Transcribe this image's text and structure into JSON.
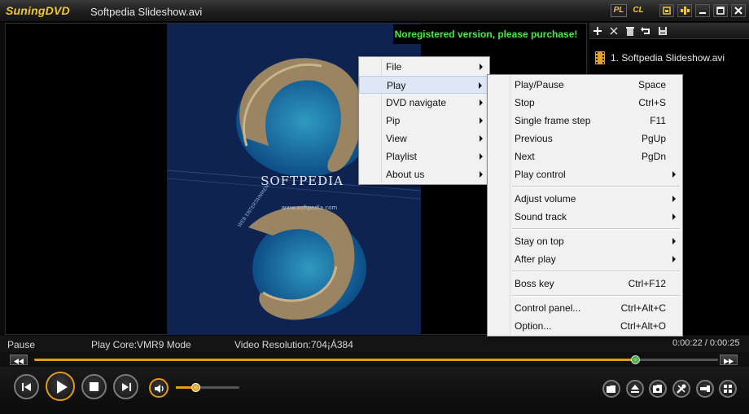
{
  "app": {
    "logo": "SuningDVD",
    "file_title": "Softpedia Slideshow.avi",
    "pl_label": "PL",
    "cl_label": "CL"
  },
  "video": {
    "nag_text": "Noregistered version, please purchase!",
    "watermark_text": "SOFTPEDIA",
    "watermark_url": "www.softpedia.com",
    "watermark_side": "WEB ENTERTAINMENT"
  },
  "playlist": {
    "items": [
      {
        "label": "1. Softpedia Slideshow.avi"
      }
    ]
  },
  "status": {
    "state": "Pause",
    "core": "Play Core:VMR9 Mode",
    "resolution": "Video Resolution:704¡Á384",
    "time": "0:00:22 / 0:00:25"
  },
  "seek": {
    "progress": 0.88
  },
  "volume": {
    "level": 0.32
  },
  "main_menu": {
    "items": [
      {
        "label": "File"
      },
      {
        "label": "Play"
      },
      {
        "label": "DVD navigate"
      },
      {
        "label": "Pip"
      },
      {
        "label": "View"
      },
      {
        "label": "Playlist"
      },
      {
        "label": "About us"
      }
    ]
  },
  "play_menu": {
    "play_pause": {
      "label": "Play/Pause",
      "key": "Space"
    },
    "stop": {
      "label": "Stop",
      "key": "Ctrl+S"
    },
    "single_frame": {
      "label": "Single frame step",
      "key": "F11"
    },
    "previous": {
      "label": "Previous",
      "key": "PgUp"
    },
    "next": {
      "label": "Next",
      "key": "PgDn"
    },
    "play_control": {
      "label": "Play control"
    },
    "adjust_volume": {
      "label": "Adjust volume"
    },
    "sound_track": {
      "label": "Sound track"
    },
    "stay_on_top": {
      "label": "Stay on top"
    },
    "after_play": {
      "label": "After play"
    },
    "boss_key": {
      "label": "Boss key",
      "key": "Ctrl+F12"
    },
    "control_panel": {
      "label": "Control panel...",
      "key": "Ctrl+Alt+C"
    },
    "option": {
      "label": "Option...",
      "key": "Ctrl+Alt+O"
    }
  },
  "colors": {
    "accent": "#e39a1a",
    "logo": "#f2c832",
    "nag": "#3ef03a"
  }
}
